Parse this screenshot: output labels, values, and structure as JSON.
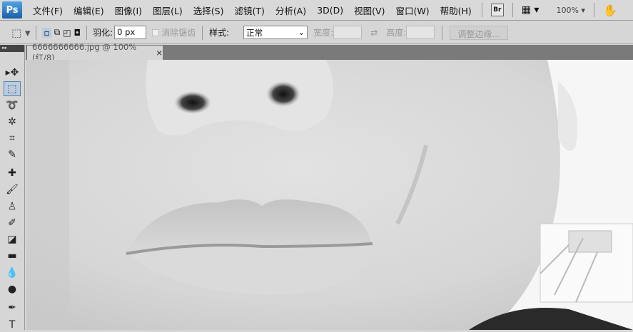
{
  "app": {
    "logo": "Ps"
  },
  "menu": [
    "文件(F)",
    "编辑(E)",
    "图像(I)",
    "图层(L)",
    "选择(S)",
    "滤镜(T)",
    "分析(A)",
    "3D(D)",
    "视图(V)",
    "窗口(W)",
    "帮助(H)"
  ],
  "appbar": {
    "bridge": "Br",
    "zoom": "100%"
  },
  "options": {
    "feather_label": "羽化:",
    "feather_value": "0 px",
    "antialias_label": "消除锯齿",
    "style_label": "样式:",
    "style_value": "正常",
    "width_label": "宽度:",
    "height_label": "高度:",
    "refine_edge": "调整边缘..."
  },
  "document": {
    "tab_title": "6666666666.jpg @ 100%(红/8)",
    "close": "×"
  },
  "tools": [
    {
      "name": "move-tool",
      "glyph": "▸✥"
    },
    {
      "name": "marquee-tool",
      "glyph": "⬚"
    },
    {
      "name": "lasso-tool",
      "glyph": "➰"
    },
    {
      "name": "magic-wand-tool",
      "glyph": "✲"
    },
    {
      "name": "crop-tool",
      "glyph": "⌗"
    },
    {
      "name": "eyedropper-tool",
      "glyph": "✎"
    },
    {
      "name": "healing-tool",
      "glyph": "✚"
    },
    {
      "name": "brush-tool",
      "glyph": "🖌"
    },
    {
      "name": "stamp-tool",
      "glyph": "♙"
    },
    {
      "name": "history-brush-tool",
      "glyph": "✐"
    },
    {
      "name": "eraser-tool",
      "glyph": "◪"
    },
    {
      "name": "gradient-tool",
      "glyph": "▬"
    },
    {
      "name": "blur-tool",
      "glyph": "💧"
    },
    {
      "name": "dodge-tool",
      "glyph": "●"
    },
    {
      "name": "pen-tool",
      "glyph": "✒"
    },
    {
      "name": "type-tool",
      "glyph": "T"
    }
  ]
}
